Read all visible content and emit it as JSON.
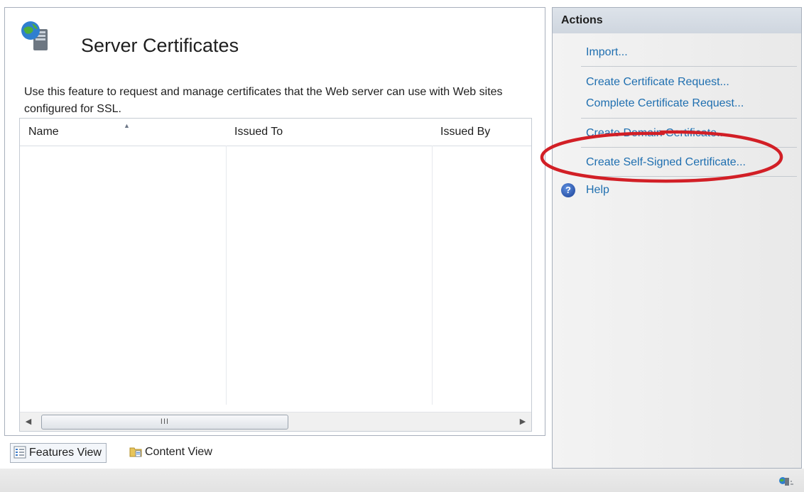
{
  "page": {
    "title": "Server Certificates",
    "description": "Use this feature to request and manage certificates that the Web server can use with Web sites configured for SSL."
  },
  "grid": {
    "columns": [
      "Name",
      "Issued To",
      "Issued By"
    ],
    "rows": []
  },
  "bottom_tabs": {
    "features_view": "Features View",
    "content_view": "Content View"
  },
  "actions": {
    "header": "Actions",
    "import": "Import...",
    "create_request": "Create Certificate Request...",
    "complete_request": "Complete Certificate Request...",
    "create_domain": "Create Domain Certificate...",
    "create_self_signed": "Create Self-Signed Certificate...",
    "help": "Help"
  },
  "scrollbar": {
    "thumb_grip": "III"
  },
  "colors": {
    "link": "#1f6fb0",
    "highlight": "#d21f26",
    "actions_header": "#d5dbe3"
  },
  "icons": [
    "server-globe-icon",
    "sort-ascending-icon",
    "features-view-icon",
    "content-view-icon",
    "help-icon",
    "status-server-icon"
  ]
}
